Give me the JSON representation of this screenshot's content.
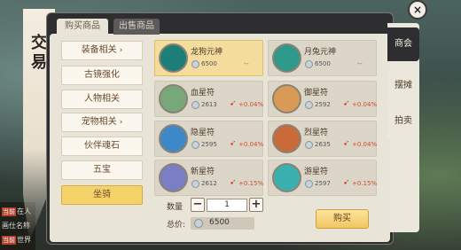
{
  "window": {
    "title_chars": [
      "交",
      "易"
    ]
  },
  "tabs": [
    {
      "label": "购买商品",
      "active": true
    },
    {
      "label": "出售商品",
      "active": false
    }
  ],
  "categories": [
    {
      "label": "装备相关",
      "arrow": "›"
    },
    {
      "label": "古镜强化",
      "arrow": ""
    },
    {
      "label": "人物相关",
      "arrow": ""
    },
    {
      "label": "宠物相关",
      "arrow": "›"
    },
    {
      "label": "伙伴魂石",
      "arrow": ""
    },
    {
      "label": "五宝",
      "arrow": ""
    },
    {
      "label": "坐骑",
      "arrow": "",
      "active": true
    }
  ],
  "items": [
    {
      "name": "龙狗元神",
      "price": "6500",
      "change": "",
      "dash": "--",
      "icon_color": "#1e7f78",
      "selected": true
    },
    {
      "name": "月兔元神",
      "price": "6500",
      "change": "",
      "dash": "--",
      "icon_color": "#2f9a8c"
    },
    {
      "name": "血星符",
      "price": "2613",
      "change": "+0.04%",
      "dash": "",
      "icon_color": "#78a77a"
    },
    {
      "name": "御星符",
      "price": "2592",
      "change": "+0.04%",
      "dash": "",
      "icon_color": "#d89a55"
    },
    {
      "name": "隐星符",
      "price": "2595",
      "change": "+0.04%",
      "dash": "",
      "icon_color": "#3d88c9"
    },
    {
      "name": "烈星符",
      "price": "2635",
      "change": "+0.04%",
      "dash": "",
      "icon_color": "#c96a3a"
    },
    {
      "name": "新星符",
      "price": "2612",
      "change": "+0.15%",
      "dash": "",
      "icon_color": "#7a7ec4"
    },
    {
      "name": "游星符",
      "price": "2597",
      "change": "+0.15%",
      "dash": "",
      "icon_color": "#3bb0b0"
    }
  ],
  "quantity": {
    "label": "数量",
    "value": "1",
    "minus": "−",
    "plus": "+"
  },
  "total": {
    "label": "总价:",
    "value": "6500"
  },
  "buy_button": "购买",
  "side_tabs": [
    {
      "label": "商会",
      "active": true
    },
    {
      "label": "摆摊",
      "active": false
    },
    {
      "label": "拍卖",
      "active": false
    }
  ],
  "close_icon": "×",
  "background_chat": [
    {
      "tag": "当前",
      "text": "在人"
    },
    {
      "tag": "",
      "text": "画仕名称"
    },
    {
      "tag": "当前",
      "text": "世界"
    }
  ]
}
